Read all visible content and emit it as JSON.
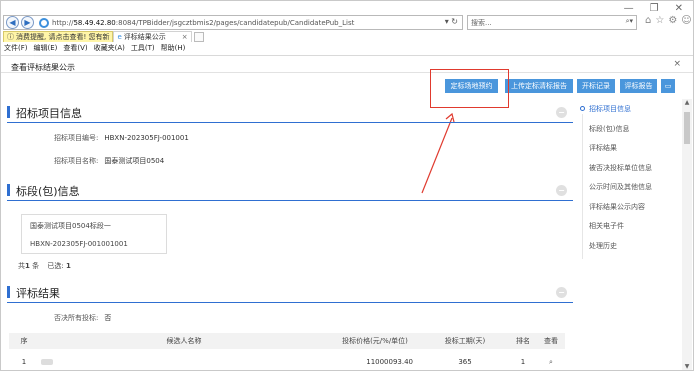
{
  "browser": {
    "url_prefix": "http://",
    "url_host": "58.49.42.80",
    "url_rest": ":8084/TPBidder/jsgcztbmis2/pages/candidatepub/CandidatePub_List",
    "search_placeholder": "搜索...",
    "tabs": [
      {
        "label": "消费提醒, 请点击查看! 您有新"
      },
      {
        "label": "评标结果公示"
      }
    ],
    "menu": [
      "文件(F)",
      "编辑(E)",
      "查看(V)",
      "收藏夹(A)",
      "工具(T)",
      "帮助(H)"
    ]
  },
  "page": {
    "title": "查看评标结果公示",
    "close_glyph": "×"
  },
  "toolbar": {
    "buttons": [
      "定标场地预约",
      "上传定标清标报告",
      "开标记录",
      "评标报告"
    ],
    "card_glyph": "▭"
  },
  "sections": {
    "project": {
      "title": "招标项目信息",
      "code_label": "招标项目编号:",
      "code_value": "HBXN-202305FJ-001001",
      "name_label": "招标项目名称:",
      "name_value": "国泰测试项目0504"
    },
    "package": {
      "title": "标段(包)信息",
      "card_name": "国泰测试项目0504标段一",
      "card_code": "HBXN-202305FJ-001001001",
      "total_prefix": "共",
      "total_count": "1",
      "total_unit": "条",
      "selected_label": "已选:",
      "selected_count": "1"
    },
    "result": {
      "title": "评标结果",
      "reject_label": "否决所有投标:",
      "reject_value": "否",
      "columns": [
        "序",
        "候选人名称",
        "投标价格(元/%/单位)",
        "投标工期(天)",
        "排名",
        "查看"
      ],
      "rows": [
        {
          "index": "1",
          "price": "11000093.40",
          "period": "365",
          "rank": "1"
        }
      ]
    }
  },
  "rightnav": [
    "招标项目信息",
    "标段(包)信息",
    "评标结果",
    "被否决投标单位信息",
    "公示时间及其他信息",
    "评标结果公示内容",
    "相关电子件",
    "处理历史"
  ],
  "colors": {
    "accent": "#4a96dc",
    "section_line": "#2f6fd1",
    "annotation": "#e03a2e"
  }
}
